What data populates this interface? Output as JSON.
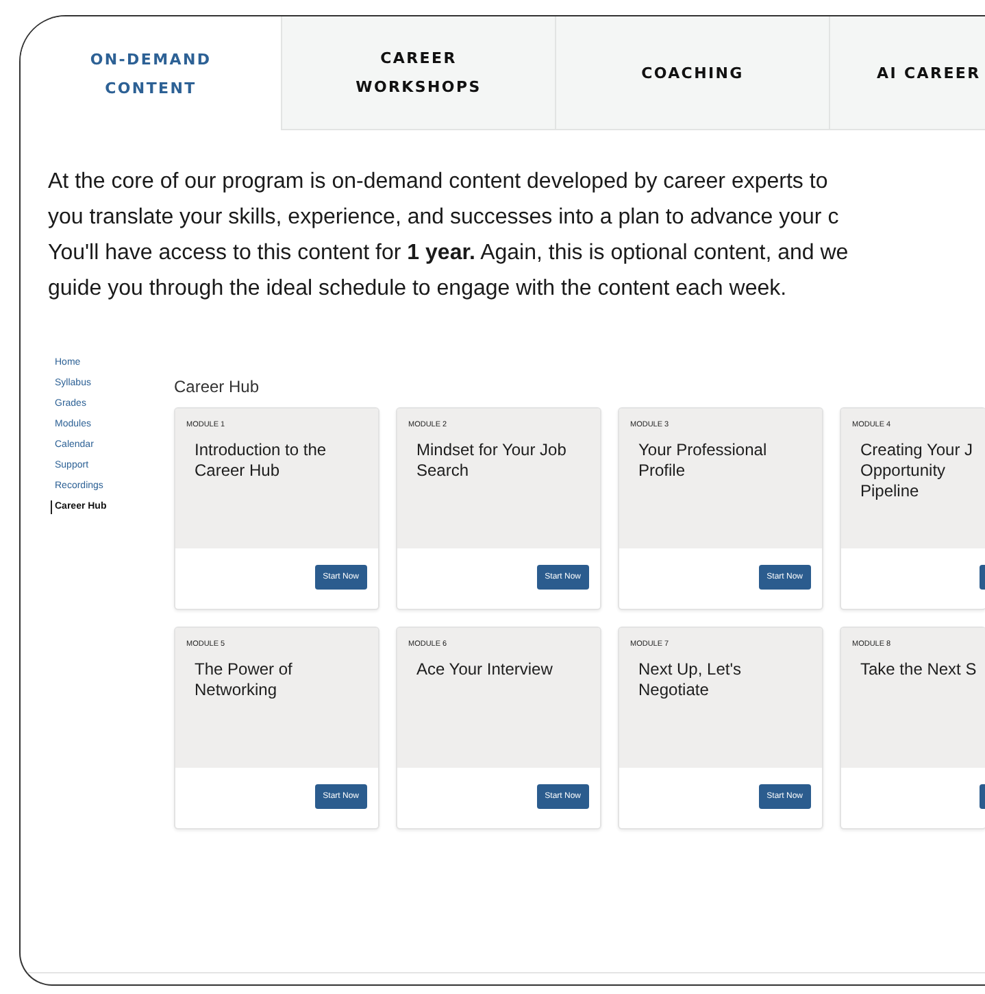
{
  "tabs": [
    {
      "label": "ON-DEMAND\nCONTENT",
      "selected": true
    },
    {
      "label": "CAREER\nWORKSHOPS",
      "selected": false
    },
    {
      "label": "COACHING",
      "selected": false
    },
    {
      "label": "AI CAREER",
      "selected": false
    }
  ],
  "intro": {
    "lines": [
      "At the core of our program is on-demand content developed by career experts to",
      "you translate your skills, experience, and successes into a plan to advance your c",
      "You'll have access to this content for **1 year.** Again, this is optional content, and we",
      "guide you through the ideal schedule to engage with the content each week."
    ]
  },
  "sidebar": {
    "items": [
      {
        "label": "Home",
        "selected": false
      },
      {
        "label": "Syllabus",
        "selected": false
      },
      {
        "label": "Grades",
        "selected": false
      },
      {
        "label": "Modules",
        "selected": false
      },
      {
        "label": "Calendar",
        "selected": false
      },
      {
        "label": "Support",
        "selected": false
      },
      {
        "label": "Recordings",
        "selected": false
      },
      {
        "label": "Career Hub",
        "selected": true
      }
    ]
  },
  "hub": {
    "title": "Career Hub",
    "modules": [
      {
        "module": "MODULE 1",
        "title": "Introduction to the Career Hub",
        "button": "Start Now"
      },
      {
        "module": "MODULE 2",
        "title": "Mindset for Your Job Search",
        "button": "Start Now"
      },
      {
        "module": "MODULE 3",
        "title": "Your Professional Profile",
        "button": "Start Now"
      },
      {
        "module": "MODULE 4",
        "title": "Creating Your J Opportunity Pipeline"
      },
      {
        "module": "MODULE 5",
        "title": "The Power of Networking",
        "button": "Start Now"
      },
      {
        "module": "MODULE 6",
        "title": "Ace Your Interview",
        "button": "Start Now"
      },
      {
        "module": "MODULE 7",
        "title": "Next Up, Let's Negotiate",
        "button": "Start Now"
      },
      {
        "module": "MODULE 8",
        "title": "Take the Next S"
      }
    ]
  }
}
